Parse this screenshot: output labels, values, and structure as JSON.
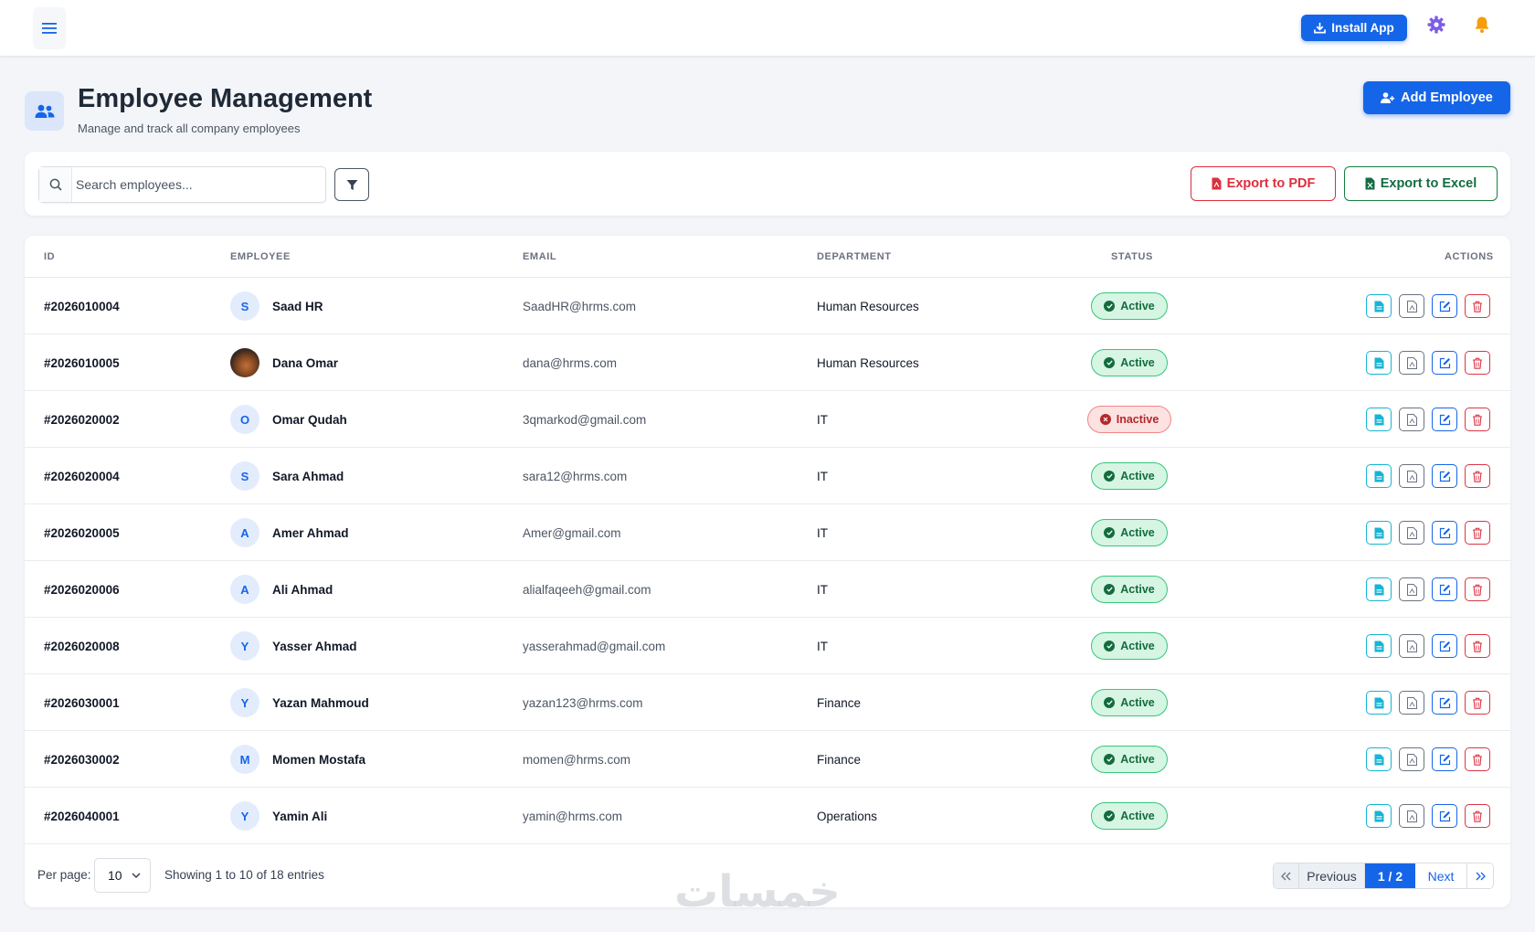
{
  "topbar": {
    "menu_icon": "hamburger-icon",
    "install_label": "Install App",
    "install_icon": "download-icon",
    "settings_icon": "gear-icon",
    "notifications_icon": "bell-icon",
    "accent_color": "#1565e8",
    "settings_color": "#7c5ce6",
    "bell_color": "#f59e0b"
  },
  "header": {
    "title": "Employee Management",
    "subtitle": "Manage and track all company employees",
    "icon": "users-icon",
    "add_label": "Add Employee",
    "add_icon": "user-plus-icon"
  },
  "toolbar": {
    "search_placeholder": "Search employees...",
    "search_value": "",
    "filter_icon": "filter-icon",
    "export_pdf_label": "Export to PDF",
    "export_excel_label": "Export to Excel"
  },
  "table": {
    "columns": [
      "ID",
      "EMPLOYEE",
      "EMAIL",
      "DEPARTMENT",
      "STATUS",
      "ACTIONS"
    ],
    "rows": [
      {
        "id": "#2026010004",
        "initial": "S",
        "name": "Saad HR",
        "email": "SaadHR@hrms.com",
        "department": "Human Resources",
        "status": "Active",
        "photo": false
      },
      {
        "id": "#2026010005",
        "initial": "",
        "name": "Dana Omar",
        "email": "dana@hrms.com",
        "department": "Human Resources",
        "status": "Active",
        "photo": true
      },
      {
        "id": "#2026020002",
        "initial": "O",
        "name": "Omar Qudah",
        "email": "3qmarkod@gmail.com",
        "department": "IT",
        "status": "Inactive",
        "photo": false
      },
      {
        "id": "#2026020004",
        "initial": "S",
        "name": "Sara Ahmad",
        "email": "sara12@hrms.com",
        "department": "IT",
        "status": "Active",
        "photo": false
      },
      {
        "id": "#2026020005",
        "initial": "A",
        "name": "Amer Ahmad",
        "email": "Amer@gmail.com",
        "department": "IT",
        "status": "Active",
        "photo": false
      },
      {
        "id": "#2026020006",
        "initial": "A",
        "name": "Ali Ahmad",
        "email": "alialfaqeeh@gmail.com",
        "department": "IT",
        "status": "Active",
        "photo": false
      },
      {
        "id": "#2026020008",
        "initial": "Y",
        "name": "Yasser Ahmad",
        "email": "yasserahmad@gmail.com",
        "department": "IT",
        "status": "Active",
        "photo": false
      },
      {
        "id": "#2026030001",
        "initial": "Y",
        "name": "Yazan Mahmoud",
        "email": "yazan123@hrms.com",
        "department": "Finance",
        "status": "Active",
        "photo": false
      },
      {
        "id": "#2026030002",
        "initial": "M",
        "name": "Momen Mostafa",
        "email": "momen@hrms.com",
        "department": "Finance",
        "status": "Active",
        "photo": false
      },
      {
        "id": "#2026040001",
        "initial": "Y",
        "name": "Yamin Ali",
        "email": "yamin@hrms.com",
        "department": "Operations",
        "status": "Active",
        "photo": false
      }
    ],
    "action_icons": [
      "file-icon",
      "pdf-icon",
      "edit-icon",
      "trash-icon"
    ]
  },
  "footer": {
    "per_page_label": "Per page:",
    "per_page_value": "10",
    "showing": "Showing 1 to 10 of 18 entries",
    "prev_label": "Previous",
    "page_indicator": "1 / 2",
    "next_label": "Next"
  },
  "watermark": "خمسات"
}
